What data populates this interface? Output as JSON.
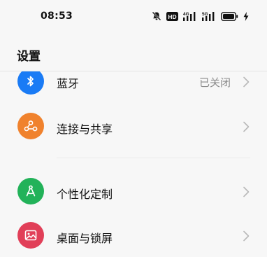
{
  "status_bar": {
    "time": "08:53",
    "icons": [
      "mute-icon",
      "hd-icon",
      "signal-4g-icon",
      "signal-5g-icon",
      "battery-icon",
      "charging-icon"
    ],
    "hd_label": "HD",
    "network_1": "4G",
    "network_2": "5G"
  },
  "header": {
    "title": "设置"
  },
  "items": [
    {
      "label": "蓝牙",
      "value": "已关闭",
      "icon": "bluetooth-icon",
      "color": "#1a7bf5"
    },
    {
      "label": "连接与共享",
      "icon": "share-icon",
      "color": "#f0822d"
    },
    {
      "label": "个性化定制",
      "icon": "personalize-icon",
      "color": "#22b259"
    },
    {
      "label": "桌面与锁屏",
      "icon": "wallpaper-icon",
      "color": "#e13f58"
    }
  ]
}
